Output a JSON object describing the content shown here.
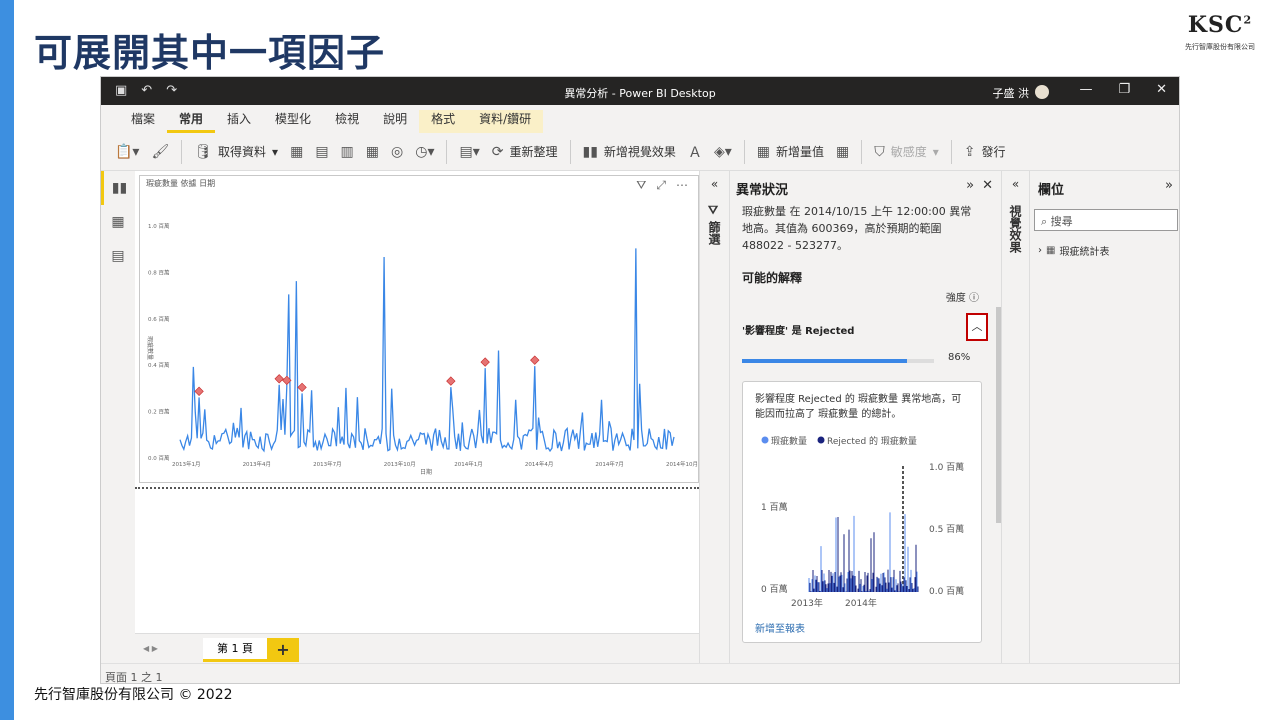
{
  "slide": {
    "title": "可展開其中一項因子",
    "footer": "先行智庫股份有限公司 © 2022",
    "logo_text": "KSC",
    "logo_sup": "2",
    "logo_sub": "先行智庫股份有限公司"
  },
  "window": {
    "title": "異常分析 - Power BI Desktop",
    "user": "子盛 洪"
  },
  "menu": [
    "檔案",
    "常用",
    "插入",
    "模型化",
    "檢視",
    "說明",
    "格式",
    "資料/鑽研"
  ],
  "ribbon": {
    "get_data": "取得資料",
    "refresh": "重新整理",
    "new_visual": "新增視覺效果",
    "new_measure": "新增量值",
    "sensitivity": "敏感度",
    "publish": "發行"
  },
  "visual": {
    "title": "瑕疵數量 依據 日期",
    "y_ticks": [
      "1.0 百萬",
      "0.8 百萬",
      "0.6 百萬",
      "0.4 百萬",
      "0.2 百萬",
      "0.0 百萬"
    ],
    "x_ticks": [
      "2013年1月",
      "2013年4月",
      "2013年7月",
      "2013年10月",
      "2014年1月",
      "2014年4月",
      "2014年7月",
      "2014年10月"
    ],
    "x_label": "日期",
    "y_label": "瑕疵數量"
  },
  "filters_label": "篩選",
  "anomaly": {
    "title": "異常狀況",
    "description": "瑕疵數量 在 2014/10/15 上午 12:00:00 異常地高。其值為 600369，高於預期的範圍 488022 - 523277。",
    "possible": "可能的解釋",
    "strength": "強度",
    "factor": "'影響程度' 是 Rejected",
    "percent": "86%",
    "percent_value": 0.86,
    "card_text": "影響程度 Rejected 的 瑕疵數量 異常地高，可能因而拉高了 瑕疵數量 的總計。",
    "legend": [
      "瑕疵數量",
      "Rejected 的 瑕疵數量"
    ],
    "left_axis": [
      "1 百萬",
      "0 百萬"
    ],
    "right_axis": [
      "1.0 百萬",
      "0.5 百萬",
      "0.0 百萬"
    ],
    "years": [
      "2013年",
      "2014年"
    ],
    "link": "新增至報表"
  },
  "viz_label": "視覺效果",
  "fields": {
    "title": "欄位",
    "search_placeholder": "搜尋",
    "table": "瑕疵統計表"
  },
  "page_tab": "第 1 頁",
  "status": "頁面 1 之 1",
  "colors": {
    "accent": "#f2c811",
    "line": "#3a87e6",
    "anomaly": "#e57373",
    "rejected": "#1a237e"
  }
}
